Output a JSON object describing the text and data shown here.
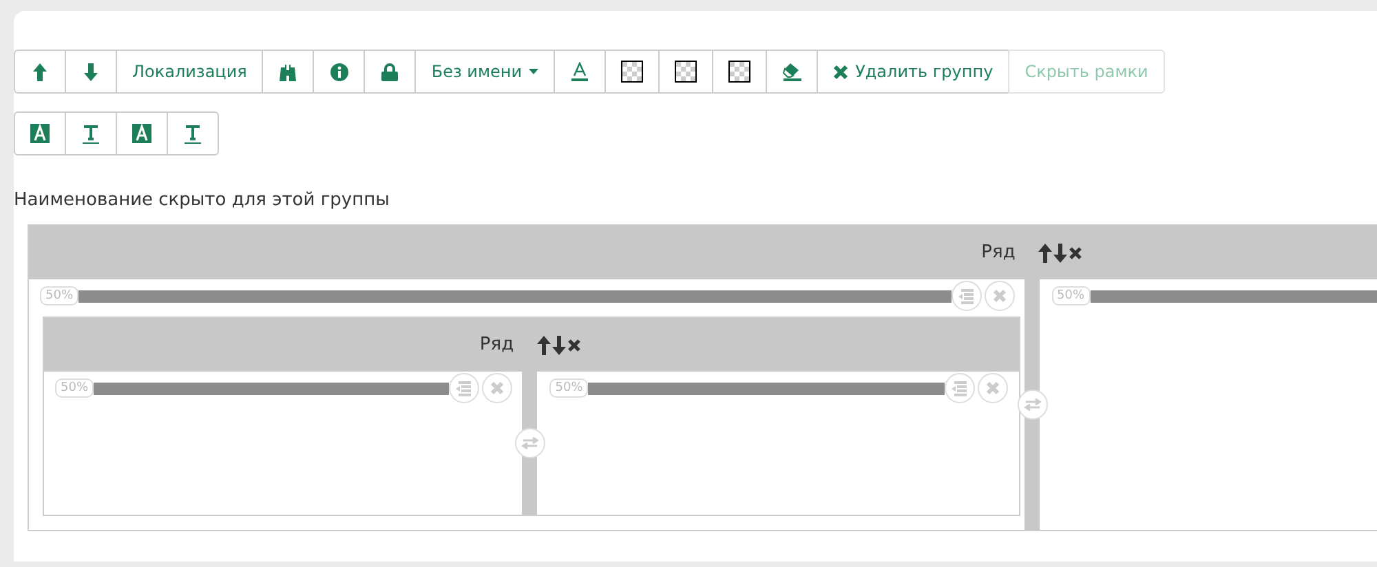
{
  "toolbar_rows": [
    [
      {
        "kind": "up",
        "disabled": false
      },
      {
        "kind": "down",
        "disabled": false
      },
      {
        "kind": "text",
        "label": "Локализация",
        "disabled": false
      },
      {
        "kind": "binoculars",
        "disabled": false
      },
      {
        "kind": "info",
        "disabled": false
      },
      {
        "kind": "lock",
        "disabled": false
      },
      {
        "kind": "dropdown",
        "label": "Без имени",
        "disabled": false
      },
      {
        "kind": "font-color",
        "disabled": false
      },
      {
        "kind": "swatch",
        "disabled": false
      },
      {
        "kind": "swatch",
        "disabled": false
      },
      {
        "kind": "swatch",
        "disabled": false
      },
      {
        "kind": "eraser",
        "disabled": false
      },
      {
        "kind": "delete",
        "label": "Удалить группу",
        "disabled": false
      },
      {
        "kind": "text",
        "label": "Скрыть рамки",
        "disabled": true
      }
    ],
    [
      {
        "kind": "text-bg",
        "disabled": false
      },
      {
        "kind": "text-line",
        "disabled": false
      },
      {
        "kind": "text-bg",
        "disabled": false
      },
      {
        "kind": "text-line",
        "disabled": false
      }
    ]
  ],
  "caption": "Наименование скрыто для этой группы",
  "group": {
    "title": "Ряд",
    "columns": [
      {
        "width_label": "50%",
        "group": {
          "title": "Ряд",
          "columns": [
            {
              "width_label": "50%"
            },
            {
              "width_label": "50%"
            }
          ]
        }
      },
      {
        "width_label": "50%"
      }
    ]
  }
}
